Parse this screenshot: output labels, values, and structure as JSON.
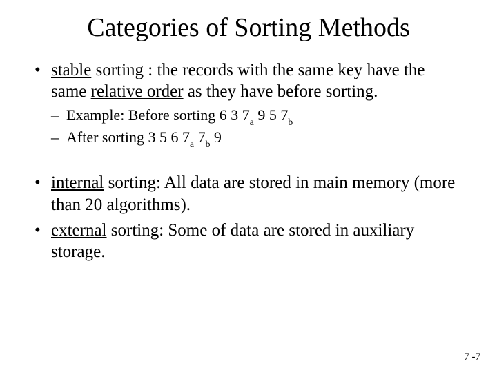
{
  "title": "Categories of Sorting Methods",
  "bullets": {
    "stable": {
      "term": "stable",
      "rest1": "  sorting  : the records with the same key have the same ",
      "rel": "relative order",
      "rest2": " as they have before sorting."
    },
    "example": {
      "before_label": "Example: Before sorting ",
      "before_seq1": "6 3 7",
      "sub_a": "a",
      "before_seq2": " 9 5 7",
      "sub_b": "b",
      "after_label": "After sorting ",
      "after_seq1": "3 5 6 7",
      "after_seq2": " 7",
      "after_seq3": " 9"
    },
    "internal": {
      "term": "internal",
      "rest": "  sorting: All data are stored in main memory (more than 20 algorithms)."
    },
    "external": {
      "term": "external",
      "rest": " sorting: Some of data are stored in auxiliary storage."
    }
  },
  "page_num": "7 -7"
}
